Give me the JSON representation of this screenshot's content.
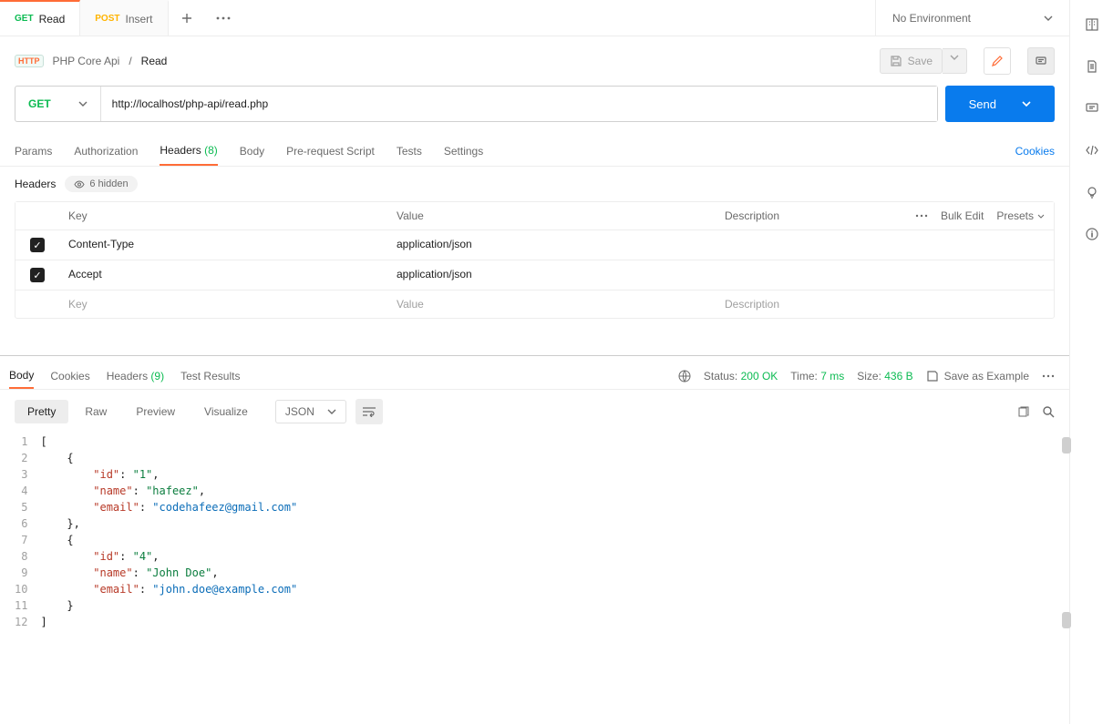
{
  "tabs": [
    {
      "method": "GET",
      "name": "Read",
      "active": true
    },
    {
      "method": "POST",
      "name": "Insert",
      "active": false
    }
  ],
  "environment": {
    "label": "No Environment"
  },
  "breadcrumb": {
    "collection": "PHP Core Api",
    "request": "Read"
  },
  "save_label": "Save",
  "request": {
    "method": "GET",
    "url": "http://localhost/php-api/read.php"
  },
  "send_label": "Send",
  "subtabs": {
    "params": "Params",
    "auth": "Authorization",
    "headers_label": "Headers",
    "headers_count": "(8)",
    "body": "Body",
    "pre": "Pre-request Script",
    "tests": "Tests",
    "settings": "Settings",
    "cookies": "Cookies"
  },
  "headers_section": {
    "title": "Headers",
    "hidden": "6 hidden",
    "cols": {
      "key": "Key",
      "value": "Value",
      "desc": "Description",
      "bulk": "Bulk Edit",
      "presets": "Presets"
    },
    "rows": [
      {
        "key": "Content-Type",
        "value": "application/json"
      },
      {
        "key": "Accept",
        "value": "application/json"
      }
    ],
    "placeholders": {
      "key": "Key",
      "value": "Value",
      "desc": "Description"
    }
  },
  "response_tabs": {
    "body": "Body",
    "cookies": "Cookies",
    "headers_label": "Headers",
    "headers_count": "(9)",
    "tests": "Test Results"
  },
  "response_meta": {
    "status_label": "Status:",
    "status_value": "200 OK",
    "time_label": "Time:",
    "time_value": "7 ms",
    "size_label": "Size:",
    "size_value": "436 B",
    "save_example": "Save as Example"
  },
  "view": {
    "pretty": "Pretty",
    "raw": "Raw",
    "preview": "Preview",
    "visualize": "Visualize",
    "format": "JSON"
  },
  "code_lines": 12,
  "response_body": [
    {
      "id": "1",
      "name": "hafeez",
      "email": "codehafeez@gmail.com"
    },
    {
      "id": "4",
      "name": "John Doe",
      "email": "john.doe@example.com"
    }
  ]
}
